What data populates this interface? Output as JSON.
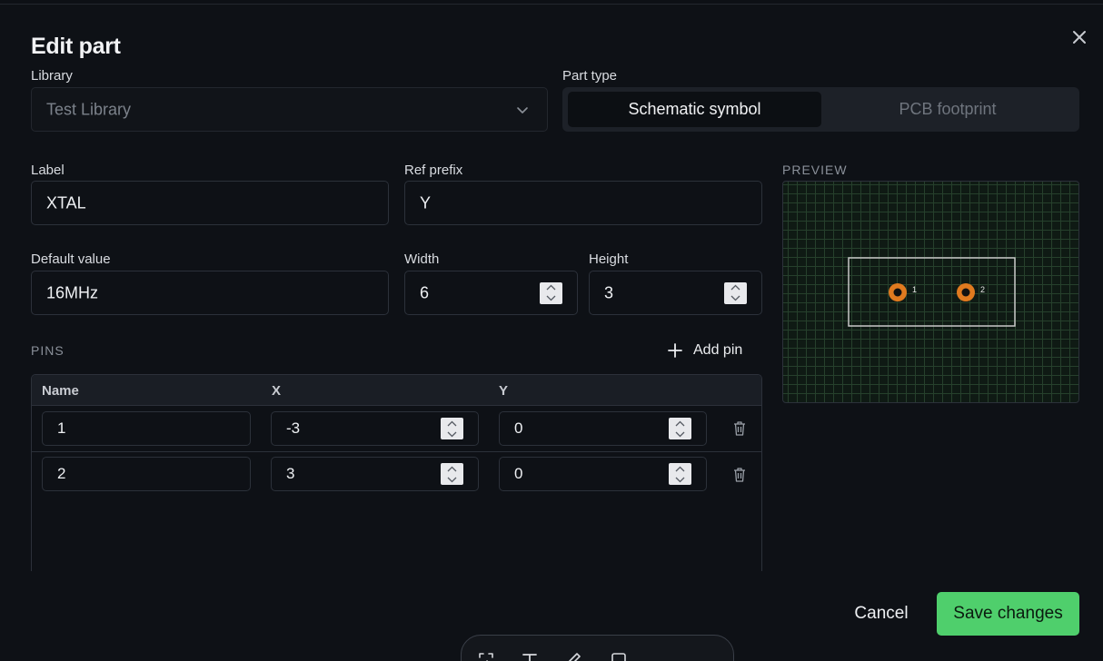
{
  "dialog": {
    "title": "Edit part",
    "close_icon": "close-icon"
  },
  "library": {
    "label": "Library",
    "value": "Test Library"
  },
  "part_type": {
    "label": "Part type",
    "options": [
      "Schematic symbol",
      "PCB footprint"
    ],
    "selected": "Schematic symbol"
  },
  "fields": {
    "label_label": "Label",
    "label_value": "XTAL",
    "ref_prefix_label": "Ref prefix",
    "ref_prefix_value": "Y",
    "default_value_label": "Default value",
    "default_value_value": "16MHz",
    "width_label": "Width",
    "width_value": "6",
    "height_label": "Height",
    "height_value": "3"
  },
  "pins": {
    "section_title": "PINS",
    "add_label": "Add pin",
    "columns": [
      "Name",
      "X",
      "Y"
    ],
    "rows": [
      {
        "name": "1",
        "x": "-3",
        "y": "0"
      },
      {
        "name": "2",
        "x": "3",
        "y": "0"
      }
    ]
  },
  "preview": {
    "title": "PREVIEW",
    "pin_labels": [
      "1",
      "2"
    ],
    "pad_color": "#e07a1f",
    "outline_color": "#c8c8c8"
  },
  "actions": {
    "cancel": "Cancel",
    "save": "Save changes",
    "save_color": "#4fcf6c"
  },
  "dock": {
    "tools": [
      "select-icon",
      "text-icon",
      "pencil-icon",
      "rectangle-icon"
    ]
  }
}
